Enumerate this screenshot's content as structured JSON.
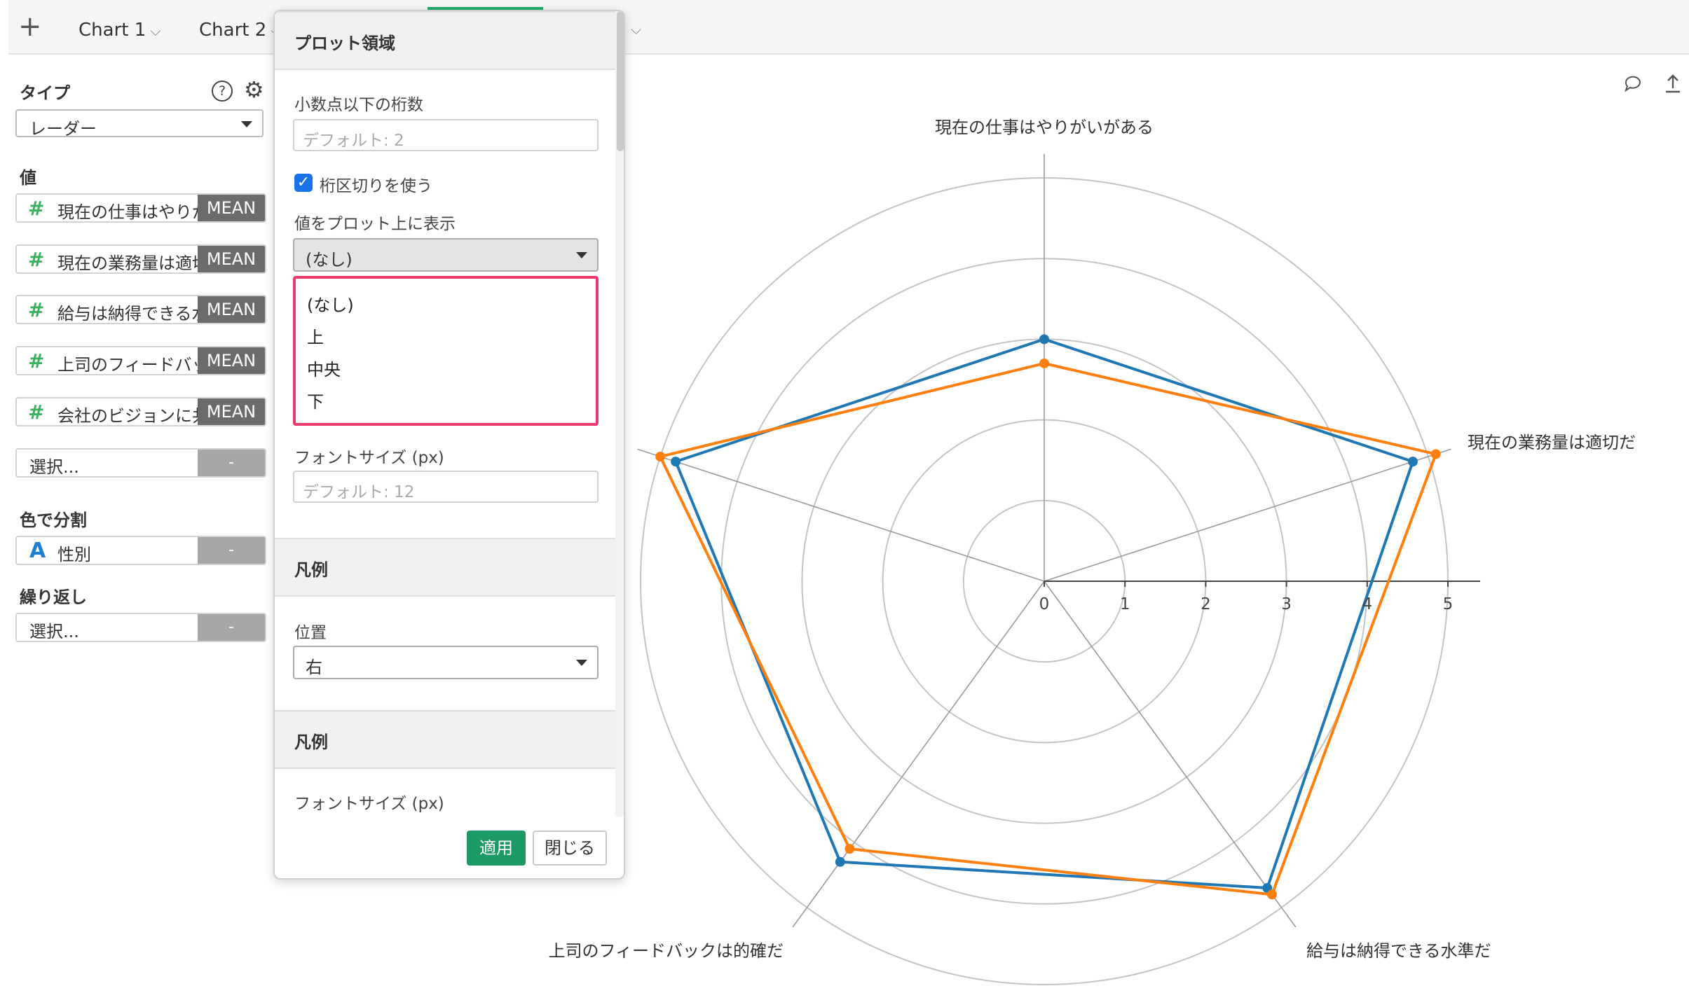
{
  "tabs": {
    "add_label": "+",
    "items": [
      {
        "label": "Chart 1"
      },
      {
        "label": "Chart 2"
      }
    ]
  },
  "left_panel": {
    "type_section": {
      "title": "タイプ",
      "help": "?",
      "selected": "レーダー"
    },
    "values_section": {
      "title": "値",
      "fields": [
        {
          "label": "現在の仕事はやりがいがある",
          "agg": "MEAN"
        },
        {
          "label": "現在の業務量は適切だ",
          "agg": "MEAN"
        },
        {
          "label": "給与は納得できる水準だ",
          "agg": "MEAN"
        },
        {
          "label": "上司のフィードバックは的確だ",
          "agg": "MEAN"
        },
        {
          "label": "会社のビジョンに共感できる",
          "agg": "MEAN"
        }
      ],
      "empty_select": {
        "label": "選択...",
        "button": "-"
      }
    },
    "color_section": {
      "title": "色で分割",
      "type_glyph": "A",
      "field": "性別",
      "button": "-"
    },
    "repeat_section": {
      "title": "繰り返し",
      "label": "選択...",
      "button": "-"
    }
  },
  "popover": {
    "section1_title": "プロット領域",
    "decimal_label": "小数点以下の桁数",
    "decimal_placeholder": "デフォルト: 2",
    "separator_label": "桁区切りを使う",
    "separator_checked": true,
    "show_values_label": "値をプロット上に表示",
    "show_values_selected": "(なし)",
    "dropdown_options": [
      "(なし)",
      "上",
      "中央",
      "下"
    ],
    "font_size_label": "フォントサイズ (px)",
    "font_size_placeholder": "デフォルト: 12",
    "legend_title": "凡例",
    "position_label": "位置",
    "position_selected": "右",
    "legend2_title": "凡例",
    "legend_font_label": "フォントサイズ (px)",
    "apply_button": "適用",
    "close_button": "閉じる"
  },
  "chart_data": {
    "type": "radar",
    "axes": [
      "現在の仕事はやりがいがある",
      "現在の業務量は適切だ",
      "給与は納得できる水準だ",
      "上司のフィードバックは的確だ",
      ""
    ],
    "scale_ticks": [
      "0",
      "1",
      "2",
      "3",
      "4",
      "5"
    ],
    "rmax": 5,
    "series": [
      {
        "color": "#1f77b4",
        "values": [
          3.0,
          4.8,
          4.7,
          4.3,
          4.8
        ]
      },
      {
        "color": "#ff7f0e",
        "values": [
          2.7,
          5.1,
          4.8,
          4.1,
          5.0
        ]
      }
    ]
  },
  "toolbar_icons": [
    "comment-icon",
    "upload-icon"
  ]
}
